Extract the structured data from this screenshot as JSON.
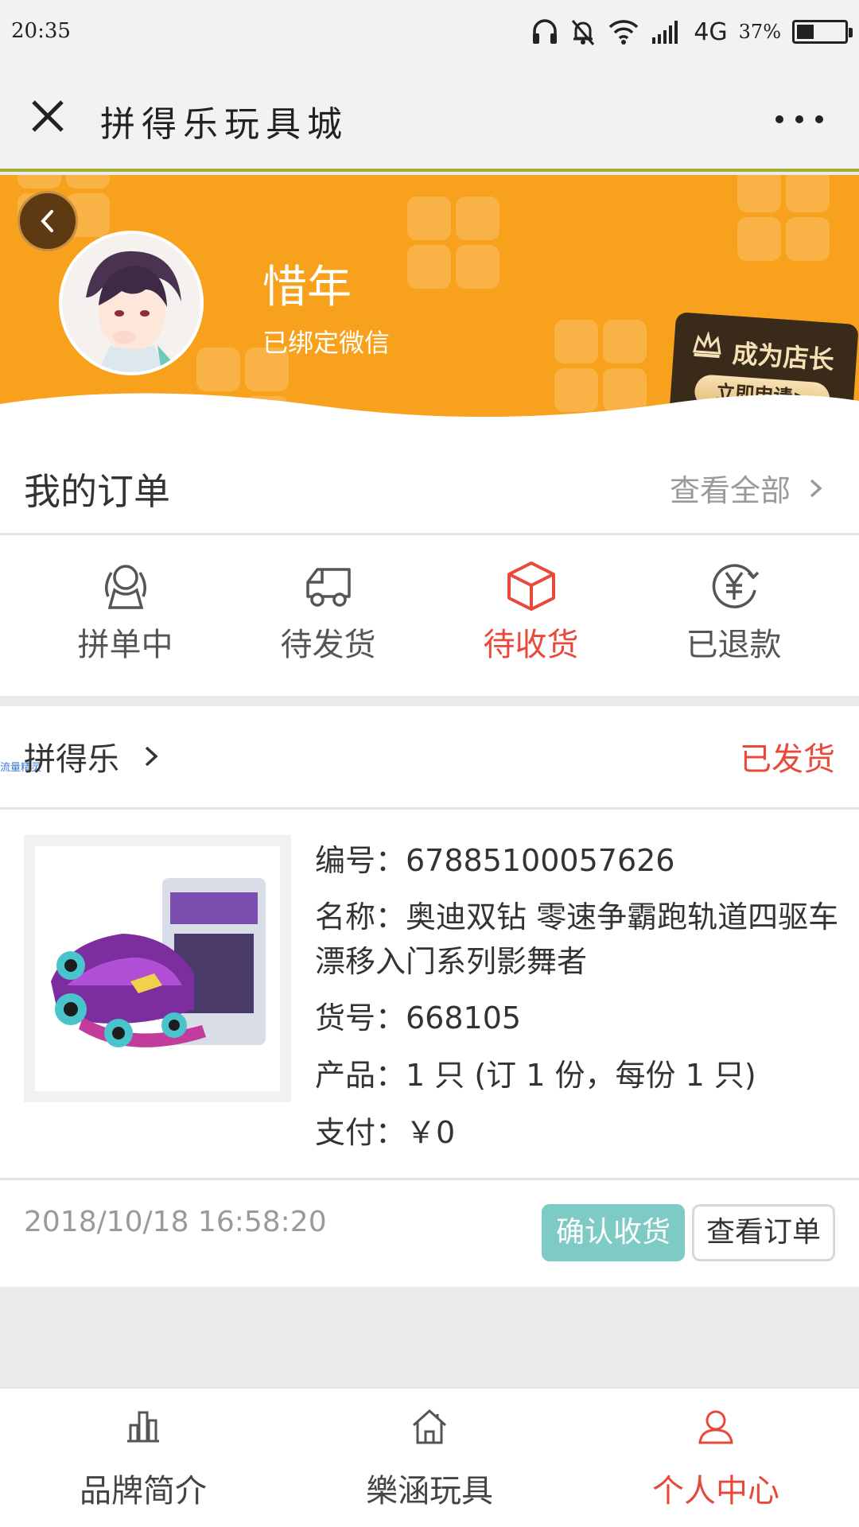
{
  "status_bar": {
    "time": "20:35",
    "network": "4G",
    "battery": "37%",
    "battery_level": 0.37
  },
  "title_bar": {
    "title": "拼得乐玩具城",
    "close_icon": "close-icon",
    "more_icon": "more-dots-icon"
  },
  "profile": {
    "username": "惜年",
    "bind_status": "已绑定微信",
    "shopkeeper_title": "成为店长",
    "shopkeeper_button": "立即申请>"
  },
  "orders": {
    "title": "我的订单",
    "view_all": "查看全部",
    "tabs": [
      {
        "label": "拼单中",
        "icon": "group-people-icon",
        "active": false
      },
      {
        "label": "待发货",
        "icon": "truck-icon",
        "active": false
      },
      {
        "label": "待收货",
        "icon": "box-icon",
        "active": true
      },
      {
        "label": "已退款",
        "icon": "yen-refund-icon",
        "active": false
      }
    ]
  },
  "order_item": {
    "shop_name": "拼得乐",
    "tiny_label": "流量精灵",
    "status": "已发货",
    "number": "编号：67885100057626",
    "name": "名称：奥迪双钻 零速争霸跑轨道四驱车 漂移入门系列影舞者",
    "sku": "货号：668105",
    "product": "产品：1 只 (订 1 份，每份 1 只)",
    "payment": "支付：￥0",
    "time": "2018/10/18 16:58:20",
    "confirm_button": "确认收货",
    "view_order_button": "查看订单"
  },
  "colors": {
    "accent_red": "#e8493b",
    "header_orange": "#f7a11c",
    "confirm_teal": "#7ecbc6"
  },
  "bottom_nav": [
    {
      "label": "品牌简介",
      "icon": "chart-icon",
      "active": false
    },
    {
      "label": "樂涵玩具",
      "icon": "home-icon",
      "active": false
    },
    {
      "label": "个人中心",
      "icon": "user-icon",
      "active": true
    }
  ]
}
